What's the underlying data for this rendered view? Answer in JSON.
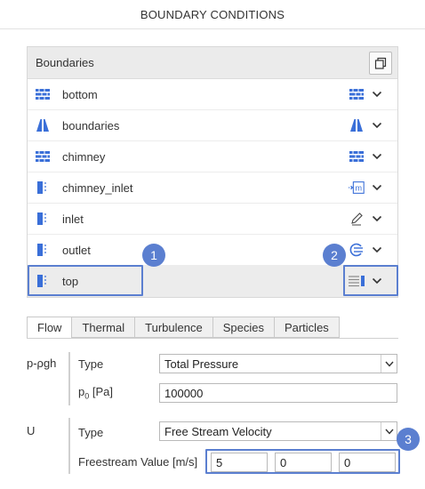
{
  "header": {
    "title": "BOUNDARY CONDITIONS"
  },
  "boundaries": {
    "title": "Boundaries",
    "items": [
      {
        "label": "bottom",
        "left_icon": "wall-icon",
        "right_icon": "wall-icon"
      },
      {
        "label": "boundaries",
        "left_icon": "symmetry-icon",
        "right_icon": "symmetry-icon"
      },
      {
        "label": "chimney",
        "left_icon": "wall-icon",
        "right_icon": "wall-icon"
      },
      {
        "label": "chimney_inlet",
        "left_icon": "patch-icon",
        "right_icon": "mass-flow-inlet-icon"
      },
      {
        "label": "inlet",
        "left_icon": "patch-icon",
        "right_icon": "pencil-icon"
      },
      {
        "label": "outlet",
        "left_icon": "patch-icon",
        "right_icon": "outflow-icon"
      },
      {
        "label": "top",
        "left_icon": "patch-icon",
        "right_icon": "freestream-icon"
      }
    ],
    "selected_index": 6
  },
  "callouts": [
    "1",
    "2",
    "3"
  ],
  "tabs": [
    "Flow",
    "Thermal",
    "Turbulence",
    "Species",
    "Particles"
  ],
  "active_tab": "Flow",
  "p_group": {
    "label": "p-ρgh",
    "type_label": "Type",
    "type_value": "Total Pressure",
    "p0_label": "p",
    "p0_sub": "0",
    "p0_unit": " [Pa]",
    "p0_value": "100000"
  },
  "u_group": {
    "label": "U",
    "type_label": "Type",
    "type_value": "Free Stream Velocity",
    "freestream_label": "Freestream Value [m/s]",
    "values": [
      "5",
      "0",
      "0"
    ]
  },
  "colors": {
    "accent": "#5b7fd0",
    "icon_blue": "#3a6fd8"
  }
}
